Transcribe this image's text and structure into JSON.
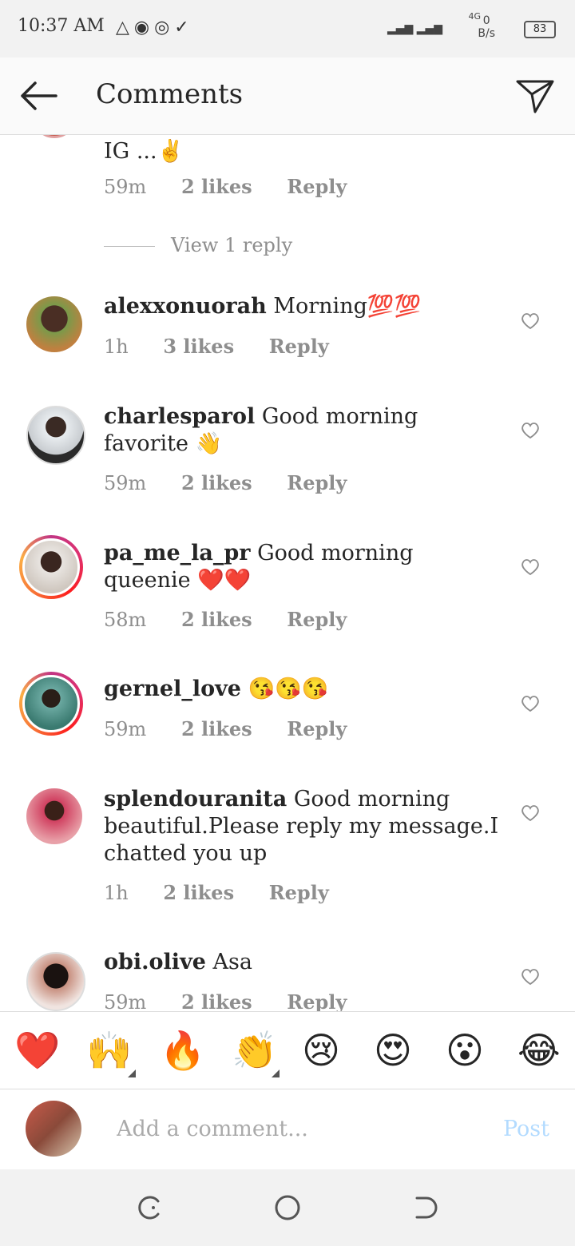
{
  "status": {
    "time": "10:37 AM",
    "network_type": "4G",
    "speed_value": "0",
    "speed_unit": "B/s",
    "battery": "83"
  },
  "header": {
    "title": "Comments"
  },
  "partial_comment": {
    "text": "IG ...✌️",
    "time": "59m",
    "likes": "2 likes",
    "reply": "Reply",
    "view_replies": "View 1 reply"
  },
  "comments": [
    {
      "user": "alexxonuorah",
      "text": "Morning💯💯",
      "time": "1h",
      "likes": "3 likes",
      "reply": "Reply"
    },
    {
      "user": "charlesparol",
      "text": "Good morning favorite 👋",
      "time": "59m",
      "likes": "2 likes",
      "reply": "Reply"
    },
    {
      "user": "pa_me_la_pr",
      "text": "Good morning queenie ❤️❤️",
      "time": "58m",
      "likes": "2 likes",
      "reply": "Reply"
    },
    {
      "user": "gernel_love",
      "text": "😘😘😘",
      "time": "59m",
      "likes": "2 likes",
      "reply": "Reply"
    },
    {
      "user": "splendouranita",
      "text": "Good morning beautiful.Please reply my message.I chatted you up",
      "time": "1h",
      "likes": "2 likes",
      "reply": "Reply"
    },
    {
      "user": "obi.olive",
      "text": "Asa",
      "time": "59m",
      "likes": "2 likes",
      "reply": "Reply"
    }
  ],
  "reactions": [
    "❤️",
    "🙌",
    "🔥",
    "👏",
    "😢",
    "😍",
    "😮",
    "😂"
  ],
  "compose": {
    "placeholder": "Add a comment...",
    "post_label": "Post"
  },
  "colors": {
    "accent_post": "#b3dbff",
    "muted_text": "#8e8e8e",
    "heart_red": "#e0242f"
  }
}
